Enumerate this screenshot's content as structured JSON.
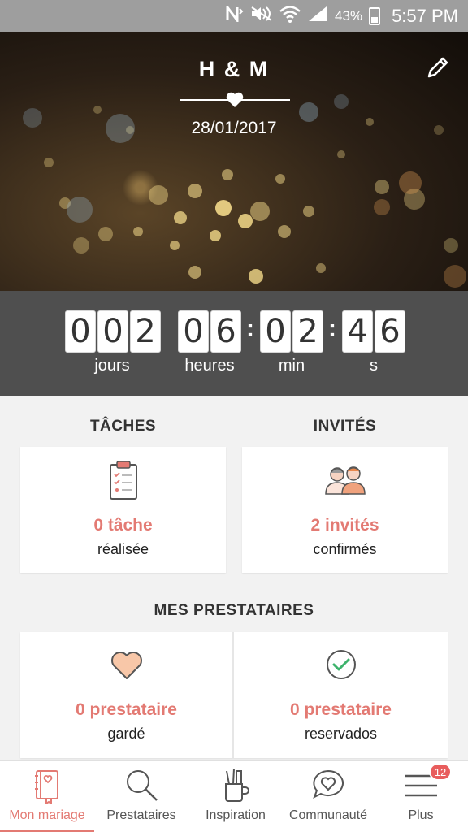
{
  "status_bar": {
    "battery": "43%",
    "time": "5:57 PM"
  },
  "hero": {
    "names": "H & M",
    "date": "28/01/2017"
  },
  "countdown": {
    "days": [
      "0",
      "0",
      "2"
    ],
    "hours": [
      "0",
      "6"
    ],
    "minutes": [
      "0",
      "2"
    ],
    "seconds": [
      "4",
      "6"
    ],
    "labels": {
      "days": "jours",
      "hours": "heures",
      "minutes": "min",
      "seconds": "s"
    }
  },
  "sections": {
    "tasks": {
      "title": "TÂCHES",
      "value": "0 tâche",
      "sub": "réalisée"
    },
    "guests": {
      "title": "INVITÉS",
      "value": "2 invités",
      "sub": "confirmés"
    },
    "providers": {
      "title": "MES PRESTATAIRES",
      "kept": {
        "value": "0 prestataire",
        "sub": "gardé"
      },
      "reserved": {
        "value": "0 prestataire",
        "sub": "reservados"
      }
    }
  },
  "nav": [
    {
      "label": "Mon mariage",
      "icon": "book-icon",
      "active": true
    },
    {
      "label": "Prestataires",
      "icon": "search-icon"
    },
    {
      "label": "Inspiration",
      "icon": "brushes-cup-icon"
    },
    {
      "label": "Communauté",
      "icon": "chat-heart-icon"
    },
    {
      "label": "Plus",
      "icon": "menu-icon",
      "badge": "12"
    }
  ],
  "colors": {
    "accent": "#e37a73",
    "countdown_bg": "#4f4f4f",
    "status_bar_bg": "#9e9e9e"
  }
}
